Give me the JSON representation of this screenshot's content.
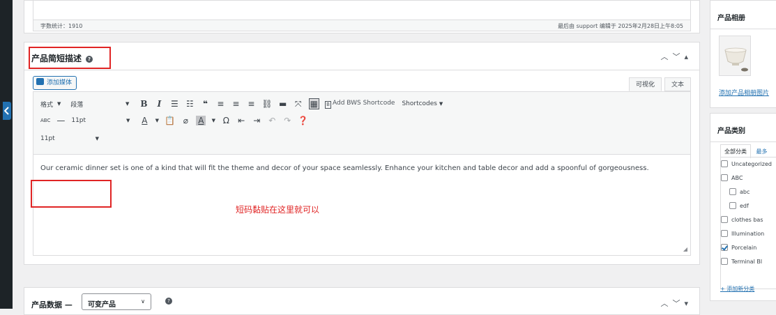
{
  "top_editor": {
    "word_count": "字数统计：1910",
    "last_edited": "最后由 support 编辑于 2025年2月28日上午8:05"
  },
  "short_description": {
    "title": "产品简短描述",
    "add_media": "添加媒体",
    "tabs": [
      "可视化",
      "文本"
    ],
    "format_select": "格式",
    "paragraph_select": "段落",
    "font_size_select": "11pt",
    "font_size_select2": "11pt",
    "bws_button": "Add BWS Shortcode",
    "shortcodes_menu": "Shortcodes",
    "content": "Our ceramic dinner set is one of a kind that will fit the theme and decor of your space seamlessly. Enhance your kitchen and table decor and add a spoonful of gorgeousness.",
    "hint": "短码黏贴在这里就可以"
  },
  "product_data": {
    "title": "产品数据 —",
    "type_select": "可变产品"
  },
  "sidebar": {
    "gallery_title": "产品相册",
    "gallery_link": "添加产品相册图片",
    "categories_title": "产品类别",
    "cat_tab_all": "全部分类",
    "cat_tab_most": "最多",
    "categories": [
      {
        "label": "Uncategorized",
        "checked": false,
        "indent": 0
      },
      {
        "label": "ABC",
        "checked": false,
        "indent": 0
      },
      {
        "label": "abc",
        "checked": false,
        "indent": 1
      },
      {
        "label": "edf",
        "checked": false,
        "indent": 1
      },
      {
        "label": "clothes bas",
        "checked": false,
        "indent": 0
      },
      {
        "label": "Illumination",
        "checked": false,
        "indent": 0
      },
      {
        "label": "Porcelain",
        "checked": true,
        "indent": 0
      },
      {
        "label": "Terminal Bl",
        "checked": false,
        "indent": 0
      }
    ],
    "add_category": "+ 添加新分类"
  },
  "colors": {
    "accent": "#2271b1",
    "highlight": "#e02424"
  }
}
